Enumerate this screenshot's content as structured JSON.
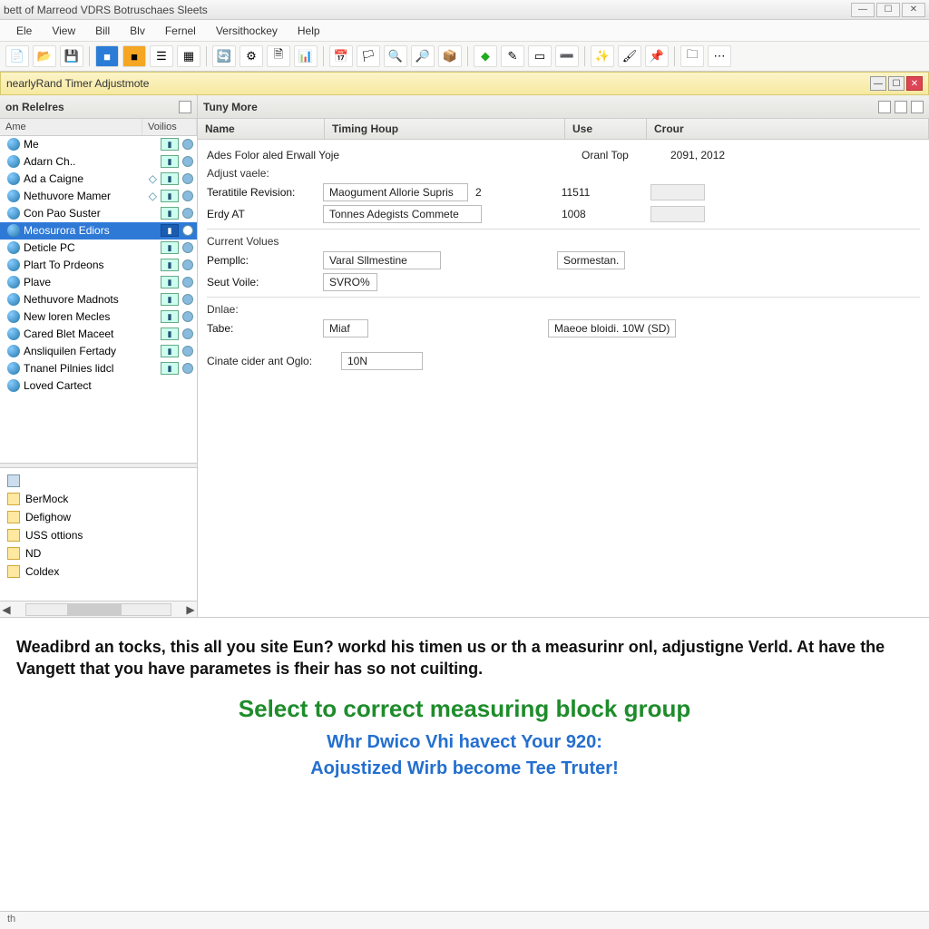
{
  "window": {
    "title": "bett of Marreod VDRS Botruschaes Sleets"
  },
  "menu": [
    "Ele",
    "View",
    "Bill",
    "Blv",
    "Fernel",
    "Versithockey",
    "Help"
  ],
  "strip": {
    "title": "nearlyRand Timer Adjustmote"
  },
  "left": {
    "pane_title": "on Relelres",
    "col_name": "Ame",
    "col_voiles": "Voilios",
    "items": [
      {
        "label": "Me",
        "sel": false
      },
      {
        "label": "Adarn Ch..",
        "sel": false
      },
      {
        "label": "Ad a Caigne",
        "sel": false
      },
      {
        "label": "Nethuvore Mamer",
        "sel": false
      },
      {
        "label": "Con Pao Suster",
        "sel": false
      },
      {
        "label": "Meosurora Ediors",
        "sel": true
      },
      {
        "label": "Deticle PC",
        "sel": false
      },
      {
        "label": "Plart To Prdeons",
        "sel": false
      },
      {
        "label": "Plave",
        "sel": false
      },
      {
        "label": "Nethuvore Madnots",
        "sel": false
      },
      {
        "label": "New loren Mecles",
        "sel": false
      },
      {
        "label": "Cared Blet Maceet",
        "sel": false
      },
      {
        "label": "Ansliquilen Fertady",
        "sel": false
      },
      {
        "label": "Tnanel Pilnies lidcl",
        "sel": false
      },
      {
        "label": "Loved Cartect",
        "sel": false
      }
    ],
    "nav": [
      "BerMock",
      "Defighow",
      "USS ottions",
      "ND",
      "Coldex"
    ]
  },
  "right": {
    "pane_title": "Tuny More",
    "columns": {
      "name": "Name",
      "timing": "Timing Houp",
      "use": "Use",
      "crour": "Crour"
    },
    "row1": {
      "name": "Ades Folor aled Erwall Yoje",
      "use": "Oranl Top",
      "crour": "2091, 2012"
    },
    "adjust_label": "Adjust vaele:",
    "terat_label": "Teratitile Revision:",
    "terat_fld": "Maogument Allorie Supris",
    "terat_num": "2",
    "terat_use": "11511",
    "erdy_label": "Erdy AT",
    "erdy_fld": "Tonnes Adegists Commete",
    "erdy_use": "1008",
    "curvals_label": "Current Volues",
    "pempllc_label": "Pempllc:",
    "pempllc_fld": "Varal Sllmestine",
    "pempllc_right": "Sormestan.",
    "seut_label": "Seut Voile:",
    "seut_fld": "SVRO%",
    "dnlae_label": "Dnlae:",
    "tabe_label": "Tabe:",
    "tabe_fld": "Miaf",
    "tabe_right": "Maeoe bloidi.  10W  (SD)",
    "cinate_label": "Cinate cider ant Oglo:",
    "cinate_fld": "10N"
  },
  "caption": {
    "p1": "Weadibrd an tocks, this all you site Eun? workd his timen us or th a measurinr onl, adjustigne Verld. At have the Vangett that you have parametes is fheir has so not cuilting.",
    "green": "Select to correct measuring block group",
    "blue1": "Whr Dwico Vhi havect Your 920:",
    "blue2": "Aojustized Wirb become Tee Truter!"
  },
  "status": "th"
}
